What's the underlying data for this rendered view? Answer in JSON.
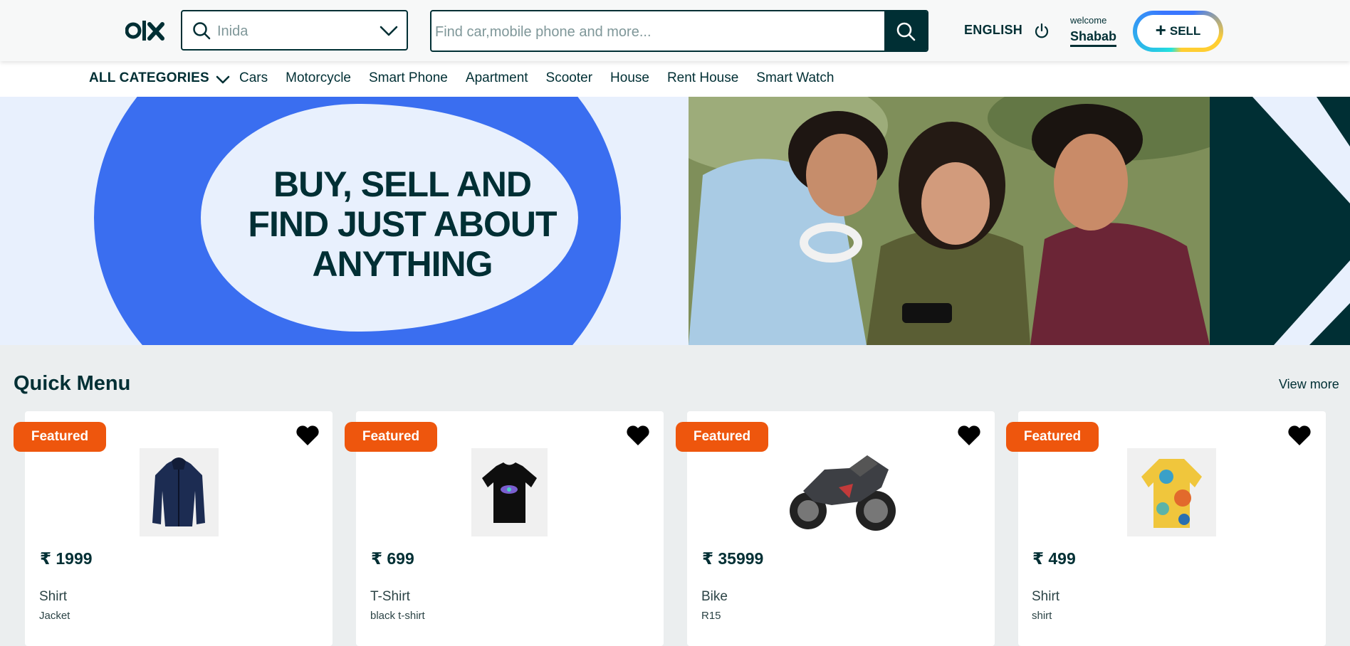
{
  "header": {
    "logo_text": "olx",
    "location_value": "Inida",
    "search_placeholder": "Find car,mobile phone and more...",
    "language": "ENGLISH",
    "welcome_label": "welcome",
    "username": "Shabab",
    "sell_label": "SELL",
    "sell_plus": "+"
  },
  "categories": {
    "all_label": "ALL CATEGORIES",
    "items": [
      "Cars",
      "Motorcycle",
      "Smart Phone",
      "Apartment",
      "Scooter",
      "House",
      "Rent House",
      "Smart Watch"
    ]
  },
  "banner": {
    "line1": "BUY, SELL AND",
    "line2": "FIND JUST ABOUT",
    "line3": "ANYTHING"
  },
  "quick_menu": {
    "title": "Quick Menu",
    "view_more": "View more",
    "products": [
      {
        "badge": "Featured",
        "price": "₹ 1999",
        "name": "Shirt",
        "desc": "Jacket",
        "image": "jacket-image"
      },
      {
        "badge": "Featured",
        "price": "₹ 699",
        "name": "T-Shirt",
        "desc": "black t-shirt",
        "image": "tshirt-image"
      },
      {
        "badge": "Featured",
        "price": "₹ 35999",
        "name": "Bike",
        "desc": "R15",
        "image": "motorbike-image"
      },
      {
        "badge": "Featured",
        "price": "₹ 499",
        "name": "Shirt",
        "desc": "shirt",
        "image": "shirt-image"
      }
    ]
  },
  "colors": {
    "primary": "#002f34",
    "accent_blue": "#3a6ef0",
    "banner_bg": "#e8f0fd",
    "featured": "#ee560d",
    "page_bg": "#ebeeef"
  }
}
